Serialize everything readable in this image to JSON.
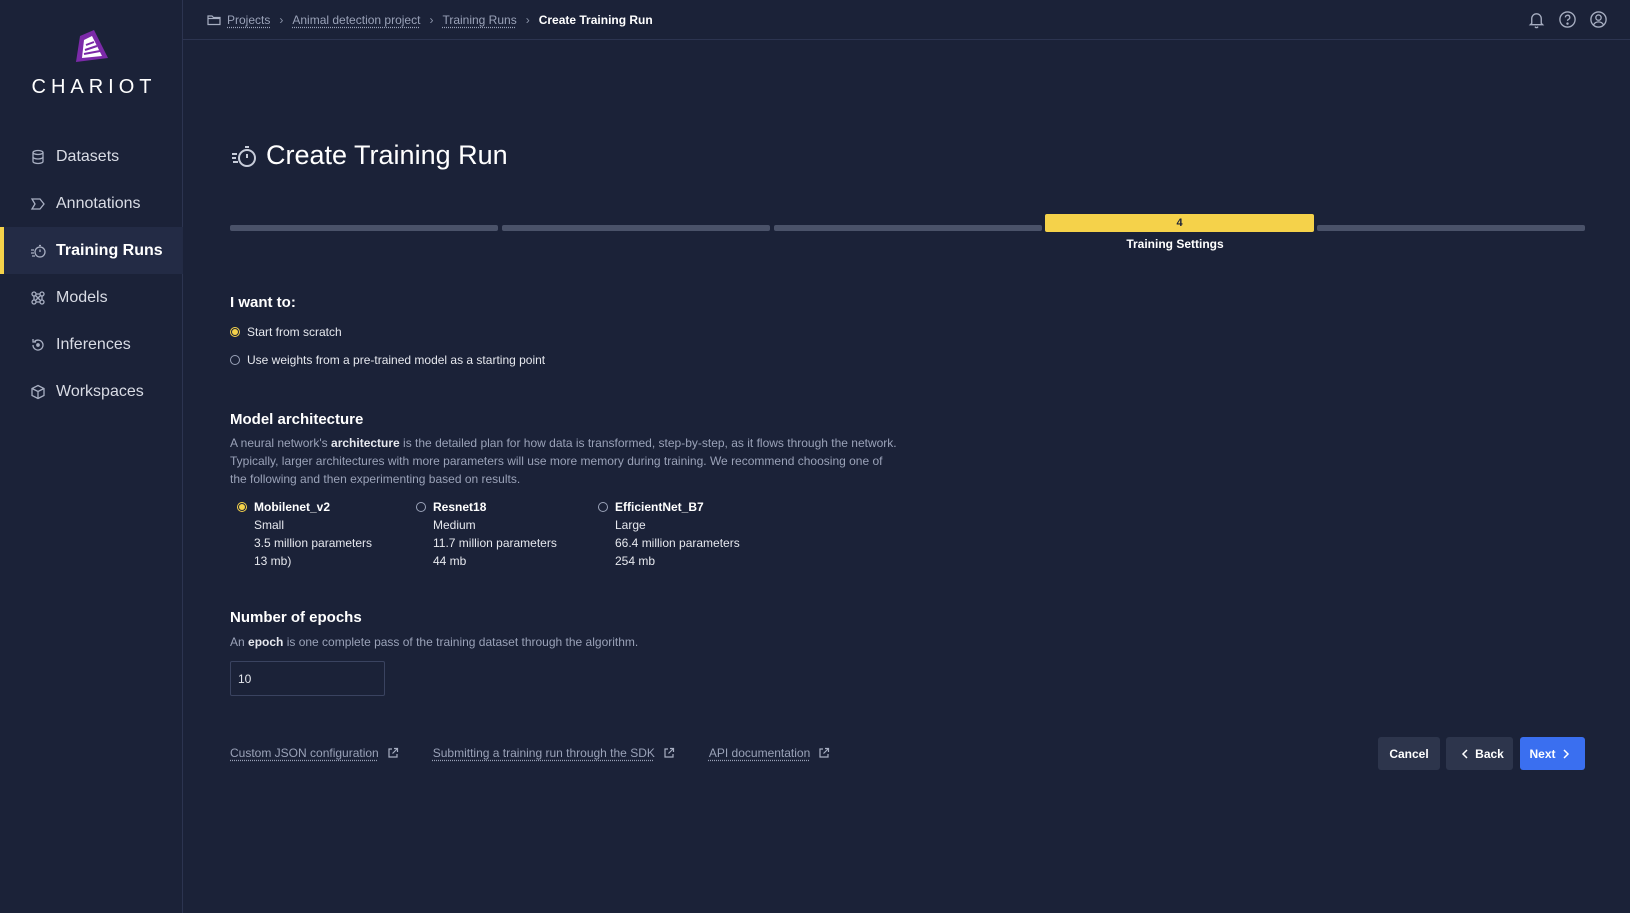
{
  "app": {
    "name": "CHARIOT"
  },
  "sidebar": {
    "items": [
      {
        "label": "Datasets",
        "icon": "database-icon",
        "active": false
      },
      {
        "label": "Annotations",
        "icon": "tag-icon",
        "active": false
      },
      {
        "label": "Training Runs",
        "icon": "stopwatch-icon",
        "active": true
      },
      {
        "label": "Models",
        "icon": "network-icon",
        "active": false
      },
      {
        "label": "Inferences",
        "icon": "refresh-icon",
        "active": false
      },
      {
        "label": "Workspaces",
        "icon": "cube-icon",
        "active": false
      }
    ]
  },
  "breadcrumb": {
    "items": [
      "Projects",
      "Animal detection project",
      "Training Runs"
    ],
    "current": "Create Training Run"
  },
  "header_icons": [
    "bell-icon",
    "help-icon",
    "user-icon"
  ],
  "page": {
    "title": "Create Training Run"
  },
  "stepper": {
    "active_step_number": "4",
    "active_step_label": "Training Settings",
    "total_steps": 5,
    "active_index": 3
  },
  "start_mode": {
    "title": "I want to:",
    "options": [
      {
        "label": "Start from scratch",
        "checked": true
      },
      {
        "label": "Use weights from a pre-trained model as a starting point",
        "checked": false
      }
    ]
  },
  "architecture": {
    "title": "Model architecture",
    "desc_prefix": "A neural network's ",
    "desc_bold": "architecture",
    "desc_suffix": " is the detailed plan for how data is transformed, step-by-step, as it flows through the network. Typically, larger architectures with more parameters will use more memory during training. We recommend choosing one of the following and then experimenting based on results.",
    "options": [
      {
        "name": "Mobilenet_v2",
        "size": "Small",
        "params": "3.5 million parameters",
        "mb": "13 mb)",
        "checked": true
      },
      {
        "name": "Resnet18",
        "size": "Medium",
        "params": "11.7 million parameters",
        "mb": "44 mb",
        "checked": false
      },
      {
        "name": "EfficientNet_B7",
        "size": "Large",
        "params": "66.4 million parameters",
        "mb": "254 mb",
        "checked": false
      }
    ]
  },
  "epochs": {
    "title": "Number of epochs",
    "desc_prefix": "An ",
    "desc_bold": "epoch",
    "desc_suffix": " is one complete pass of the training dataset through the algorithm.",
    "value": "10"
  },
  "links": [
    {
      "label": "Custom JSON configuration",
      "icon": "external-link-icon"
    },
    {
      "label": "Submitting a training run through the SDK",
      "icon": "external-link-icon"
    },
    {
      "label": "API documentation",
      "icon": "external-link-icon"
    }
  ],
  "actions": {
    "cancel": "Cancel",
    "back": "Back",
    "next": "Next"
  },
  "colors": {
    "background": "#1b2238",
    "accent": "#f5d24a",
    "primary": "#3a6ff0"
  }
}
